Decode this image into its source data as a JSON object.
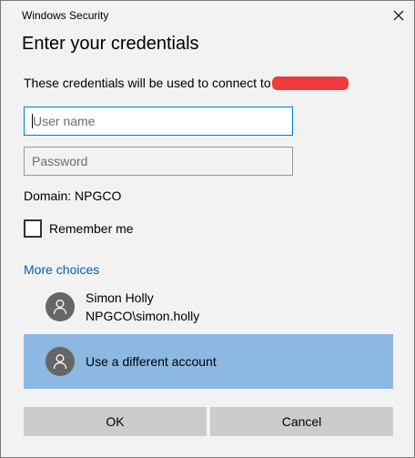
{
  "window": {
    "title": "Windows Security",
    "close_icon": "close-icon"
  },
  "dialog": {
    "heading": "Enter your credentials",
    "message": "These credentials will be used to connect to",
    "redacted_color": "#ef3b3b"
  },
  "form": {
    "username_placeholder": "User name",
    "password_placeholder": "Password",
    "domain": "Domain: NPGCO",
    "remember_label": "Remember me",
    "remember_checked": false
  },
  "more_choices": {
    "label": "More choices",
    "accounts": [
      {
        "name": "Simon Holly",
        "account": "NPGCO\\simon.holly",
        "icon": "user-icon"
      },
      {
        "name": "Use a different account",
        "icon": "user-icon",
        "selected": true
      }
    ]
  },
  "buttons": {
    "ok": "OK",
    "cancel": "Cancel"
  },
  "colors": {
    "accent": "#0078d7",
    "link": "#0063b1",
    "selected_row": "#8cb8e2",
    "button": "#cccccc"
  }
}
